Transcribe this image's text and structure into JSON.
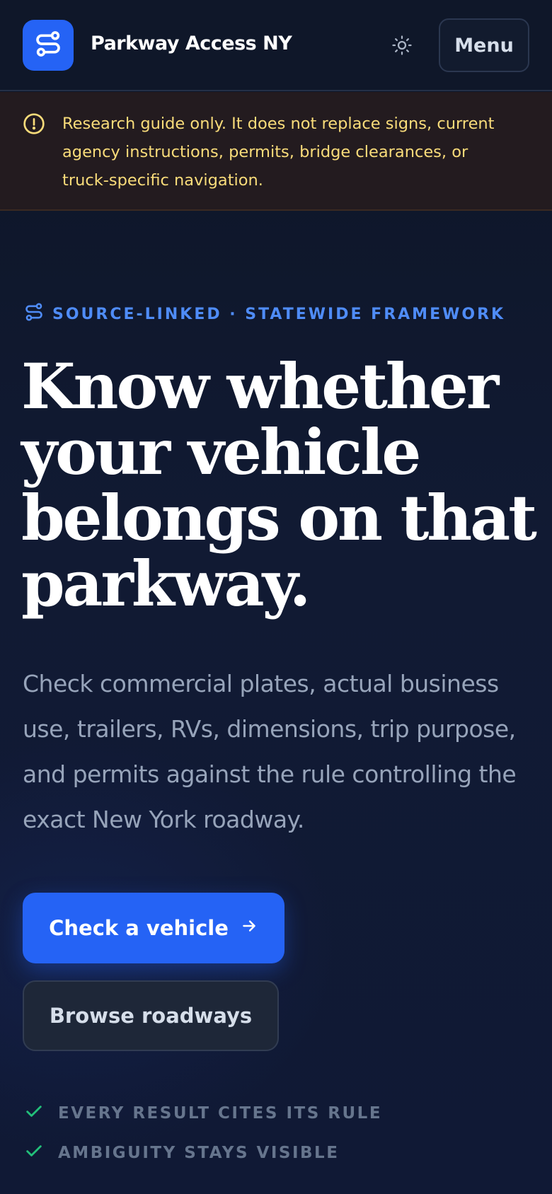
{
  "header": {
    "brand": "Parkway Access NY",
    "logo_icon": "route-icon",
    "theme_icon": "sun-icon",
    "menu_label": "Menu"
  },
  "notice": {
    "icon": "alert-circle-icon",
    "text": "Research guide only. It does not replace signs, current agency instructions, permits, bridge clearances, or truck-specific navigation."
  },
  "hero": {
    "eyebrow": "SOURCE-LINKED · STATEWIDE FRAMEWORK",
    "eyebrow_icon": "route-icon",
    "headline": "Know whether your vehicle belongs on that parkway.",
    "lede": "Check commercial plates, actual business use, trailers, RVs, dimensions, trip purpose, and permits against the rule controlling the exact New York roadway.",
    "primary_cta": "Check a vehicle",
    "primary_cta_icon": "arrow-right-icon",
    "secondary_cta": "Browse roadways",
    "checks": [
      "EVERY RESULT CITES ITS RULE",
      "AMBIGUITY STAYS VISIBLE"
    ]
  },
  "colors": {
    "accent": "#2563f5",
    "background": "#0e1627",
    "notice_text": "#f9dc7a",
    "notice_bg": "#231b1f",
    "eyebrow": "#4f8cf7",
    "check": "#22c07a"
  }
}
